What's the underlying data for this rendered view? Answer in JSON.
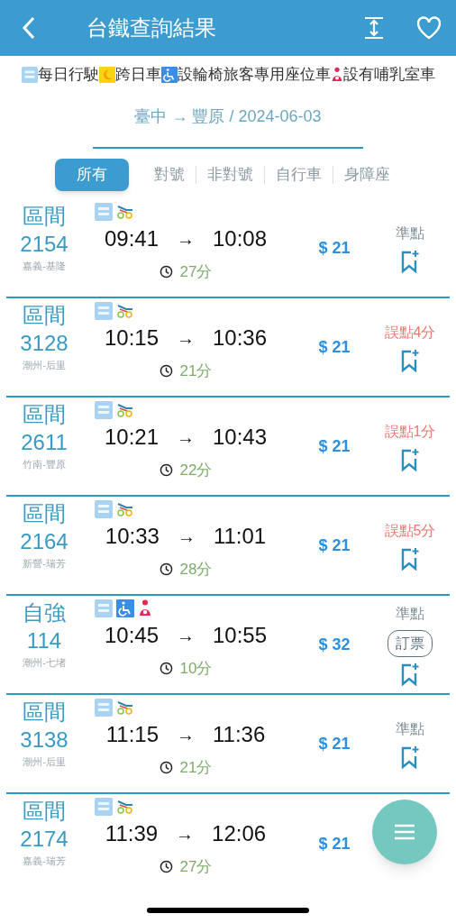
{
  "header": {
    "title": "台鐵查詢結果"
  },
  "legend": [
    {
      "kind": "daily",
      "label": "每日行駛"
    },
    {
      "kind": "overnight",
      "label": "跨日車"
    },
    {
      "kind": "wheelchair",
      "label": "設輪椅旅客專用座位車"
    },
    {
      "kind": "nursing",
      "label": "設有哺乳室車"
    }
  ],
  "route": "臺中 → 豐原 / 2024-06-03",
  "tabs": [
    {
      "label": "所有",
      "selected": true
    },
    {
      "label": "對號",
      "selected": false
    },
    {
      "label": "非對號",
      "selected": false
    },
    {
      "label": "自行車",
      "selected": false
    },
    {
      "label": "身障座",
      "selected": false
    }
  ],
  "trains": [
    {
      "type": "區間",
      "number": "2154",
      "range": "嘉義-基隆",
      "features": [
        {
          "kind": "daily"
        },
        {
          "kind": "bike"
        }
      ],
      "depart": "09:41",
      "arrow": "→",
      "arrive": "10:08",
      "duration": "27分",
      "price": "$ 21",
      "status": {
        "kind": "ontime",
        "text": "準點"
      }
    },
    {
      "type": "區間",
      "number": "3128",
      "range": "潮州-后里",
      "features": [
        {
          "kind": "daily"
        },
        {
          "kind": "bike"
        }
      ],
      "depart": "10:15",
      "arrow": "→",
      "arrive": "10:36",
      "duration": "21分",
      "price": "$ 21",
      "status": {
        "kind": "delayed",
        "text": "誤點4分"
      }
    },
    {
      "type": "區間",
      "number": "2611",
      "range": "竹南-豐原",
      "features": [
        {
          "kind": "daily"
        },
        {
          "kind": "bike"
        }
      ],
      "depart": "10:21",
      "arrow": "→",
      "arrive": "10:43",
      "duration": "22分",
      "price": "$ 21",
      "status": {
        "kind": "delayed",
        "text": "誤點1分"
      }
    },
    {
      "type": "區間",
      "number": "2164",
      "range": "新營-瑞芳",
      "features": [
        {
          "kind": "daily"
        },
        {
          "kind": "bike"
        }
      ],
      "depart": "10:33",
      "arrow": "→",
      "arrive": "11:01",
      "duration": "28分",
      "price": "$ 21",
      "status": {
        "kind": "delayed",
        "text": "誤點5分"
      }
    },
    {
      "type": "自強",
      "number": "114",
      "range": "潮州-七堵",
      "features": [
        {
          "kind": "daily"
        },
        {
          "kind": "wheelchair"
        },
        {
          "kind": "nursing"
        }
      ],
      "depart": "10:45",
      "arrow": "→",
      "arrive": "10:55",
      "duration": "10分",
      "price": "$ 32",
      "status": {
        "kind": "ontime",
        "text": "準點"
      },
      "booking": "訂票"
    },
    {
      "type": "區間",
      "number": "3138",
      "range": "潮州-后里",
      "features": [
        {
          "kind": "daily"
        },
        {
          "kind": "bike"
        }
      ],
      "depart": "11:15",
      "arrow": "→",
      "arrive": "11:36",
      "duration": "21分",
      "price": "$ 21",
      "status": {
        "kind": "ontime",
        "text": "準點"
      }
    },
    {
      "type": "區間",
      "number": "2174",
      "range": "嘉義-瑞芳",
      "features": [
        {
          "kind": "daily"
        },
        {
          "kind": "bike"
        }
      ],
      "depart": "11:39",
      "arrow": "→",
      "arrive": "12:06",
      "duration": "27分",
      "price": "$ 21"
    }
  ]
}
